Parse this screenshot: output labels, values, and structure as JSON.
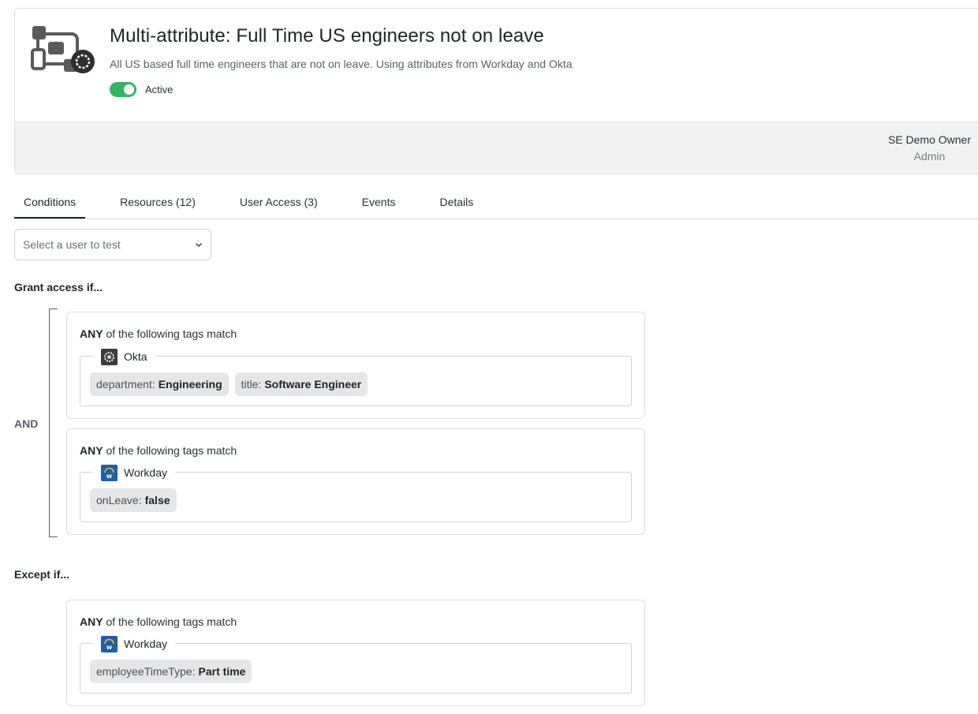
{
  "header": {
    "title": "Multi-attribute: Full Time US engineers not on leave",
    "subtitle": "All US based full time engineers that are not on leave. Using attributes from Workday and Okta",
    "status_label": "Active",
    "status_on": true,
    "logo_icon": "grouped-apps-icon",
    "owner_name": "SE Demo Owner",
    "owner_role": "Admin"
  },
  "tabs": [
    {
      "label": "Conditions",
      "active": true
    },
    {
      "label": "Resources (12)",
      "active": false
    },
    {
      "label": "User Access (3)",
      "active": false
    },
    {
      "label": "Events",
      "active": false
    },
    {
      "label": "Details",
      "active": false
    }
  ],
  "user_select": {
    "placeholder": "Select a user to test",
    "icon": "chevron-down-icon"
  },
  "grant": {
    "title": "Grant access if...",
    "operator": "AND",
    "groups": [
      {
        "match_prefix": "ANY",
        "match_suffix": "of the following tags match",
        "source": "Okta",
        "source_icon": "okta-icon",
        "tags": [
          {
            "key": "department:",
            "value": "Engineering"
          },
          {
            "key": "title:",
            "value": "Software Engineer"
          }
        ]
      },
      {
        "match_prefix": "ANY",
        "match_suffix": "of the following tags match",
        "source": "Workday",
        "source_icon": "workday-icon",
        "tags": [
          {
            "key": "onLeave:",
            "value": "false"
          }
        ]
      }
    ]
  },
  "except": {
    "title": "Except if...",
    "groups": [
      {
        "match_prefix": "ANY",
        "match_suffix": "of the following tags match",
        "source": "Workday",
        "source_icon": "workday-icon",
        "tags": [
          {
            "key": "employeeTimeType:",
            "value": "Part time"
          }
        ]
      }
    ]
  },
  "colors": {
    "accent_toggle": "#2fb564",
    "workday_blue": "#1f5ea8",
    "okta_dark": "#3b3b3b",
    "tag_bg": "#e6e6e8"
  }
}
